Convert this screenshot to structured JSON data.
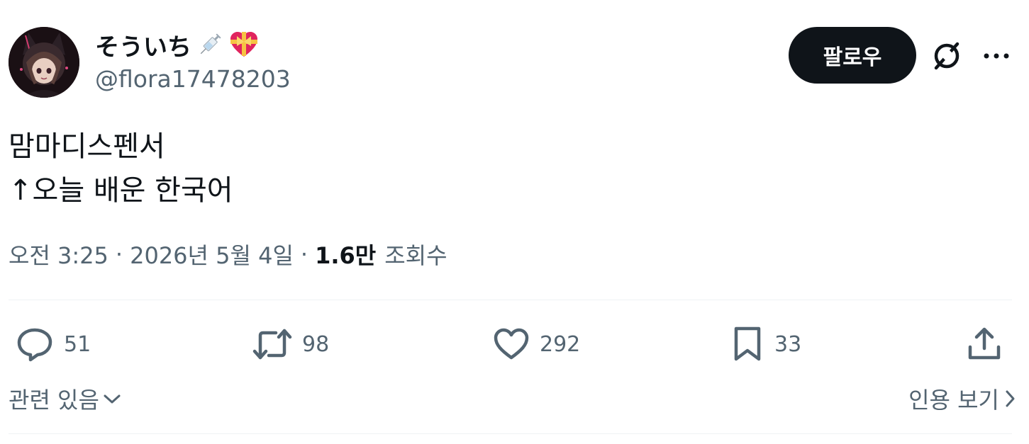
{
  "author": {
    "display_name": "そういち",
    "name_emojis": [
      "syringe-emoji",
      "heart-with-ribbon-emoji"
    ],
    "handle": "@flora17478203",
    "avatar_icon": "avatar-anime-catgirl"
  },
  "header": {
    "follow_label": "팔로우",
    "grok_icon": "grok-icon",
    "more_icon": "more-icon"
  },
  "tweet": {
    "lines": [
      "맘마디스펜서",
      "↑오늘 배운 한국어"
    ]
  },
  "meta": {
    "time": "오전 3:25",
    "separator": "·",
    "date": "2026년 5월 4일",
    "views_count": "1.6만",
    "views_label": "조회수"
  },
  "actions": {
    "reply": {
      "icon": "reply-icon",
      "count": "51"
    },
    "retweet": {
      "icon": "retweet-icon",
      "count": "98"
    },
    "like": {
      "icon": "heart-icon",
      "count": "292"
    },
    "bookmark": {
      "icon": "bookmark-icon",
      "count": "33"
    },
    "share": {
      "icon": "share-icon"
    }
  },
  "footer": {
    "related_label": "관련 있음",
    "quotes_label": "인용 보기"
  },
  "colors": {
    "text_primary": "#0f1419",
    "text_secondary": "#536471",
    "follow_bg": "#0f1419",
    "divider": "#eff3f4"
  }
}
